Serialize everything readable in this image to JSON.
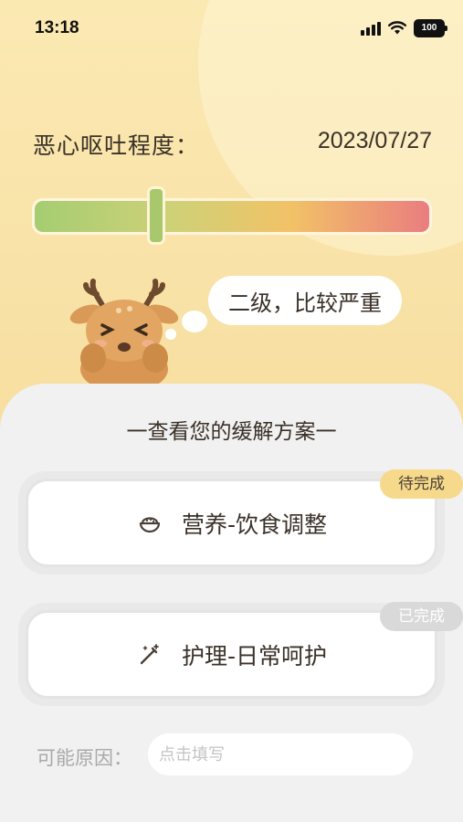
{
  "status_bar": {
    "time": "13:18",
    "battery": "100"
  },
  "severity": {
    "label": "恶心呕吐程度：",
    "date": "2023/07/27",
    "level": 0.31,
    "bubble_text": "二级，比较严重"
  },
  "plans": {
    "title": "一查看您的缓解方案一",
    "items": [
      {
        "label": "营养-饮食调整",
        "icon": "food-bowl-icon",
        "status": "待完成",
        "status_color": "#f6d98a"
      },
      {
        "label": "护理-日常呵护",
        "icon": "magic-wand-icon",
        "status": "已完成",
        "status_color": "#d9d9d9"
      }
    ]
  },
  "cause": {
    "label": "可能原因：",
    "placeholder": "点击填写",
    "value": ""
  },
  "colors": {
    "background": "#f7e3a5",
    "sheet": "#f1f1f1",
    "text": "#3a3128"
  }
}
